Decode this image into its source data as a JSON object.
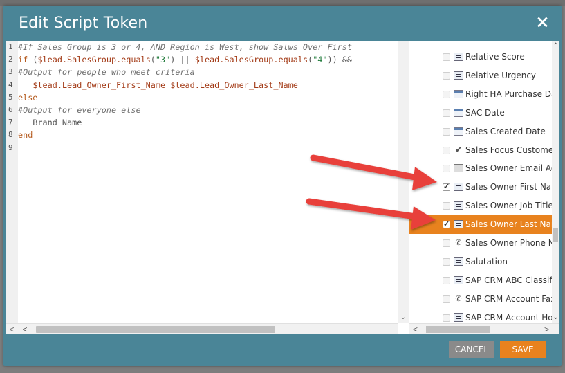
{
  "dialog": {
    "title": "Edit Script Token",
    "cancel_label": "CANCEL",
    "save_label": "SAVE"
  },
  "editor": {
    "line_numbers": [
      "1",
      "2",
      "3",
      "4",
      "5",
      "6",
      "7",
      "8",
      "9"
    ],
    "lines": [
      [
        {
          "t": "c-comment",
          "v": "#If Sales Group is 3 or 4, AND Region is West, show Salws Over First"
        }
      ],
      [
        {
          "t": "c-kw",
          "v": "if"
        },
        {
          "t": "c-op",
          "v": " ("
        },
        {
          "t": "c-var",
          "v": "$lead.SalesGroup.equals"
        },
        {
          "t": "c-op",
          "v": "("
        },
        {
          "t": "c-str",
          "v": "\"3\""
        },
        {
          "t": "c-op",
          "v": ") || "
        },
        {
          "t": "c-var",
          "v": "$lead.SalesGroup.equals"
        },
        {
          "t": "c-op",
          "v": "("
        },
        {
          "t": "c-str",
          "v": "\"4\""
        },
        {
          "t": "c-op",
          "v": ")) &&"
        }
      ],
      [
        {
          "t": "c-comment",
          "v": "#Output for people who meet criteria"
        }
      ],
      [
        {
          "t": "c-plain",
          "v": "   "
        },
        {
          "t": "c-var",
          "v": "$lead.Lead_Owner_First_Name"
        },
        {
          "t": "c-plain",
          "v": " "
        },
        {
          "t": "c-var",
          "v": "$lead.Lead_Owner_Last_Name"
        }
      ],
      [
        {
          "t": "c-kw",
          "v": "else"
        }
      ],
      [
        {
          "t": "c-comment",
          "v": "#Output for everyone else"
        }
      ],
      [
        {
          "t": "c-plain",
          "v": "   Brand Name"
        }
      ],
      [
        {
          "t": "c-kw",
          "v": "end"
        }
      ],
      [
        {
          "t": "c-plain",
          "v": ""
        }
      ]
    ]
  },
  "fields": [
    {
      "label": "Relative Score",
      "icon": "form-icon",
      "checked": false,
      "selected": false
    },
    {
      "label": "Relative Urgency",
      "icon": "form-icon",
      "checked": false,
      "selected": false
    },
    {
      "label": "Right HA Purchase Date",
      "icon": "calendar-icon",
      "checked": false,
      "selected": false
    },
    {
      "label": "SAC Date",
      "icon": "calendar-icon",
      "checked": false,
      "selected": false
    },
    {
      "label": "Sales Created Date",
      "icon": "calendar-icon",
      "checked": false,
      "selected": false
    },
    {
      "label": "Sales Focus Customer",
      "icon": "checkmark-icon",
      "checked": false,
      "selected": false
    },
    {
      "label": "Sales Owner Email Addr",
      "icon": "email-icon",
      "checked": false,
      "selected": false
    },
    {
      "label": "Sales Owner First Name",
      "icon": "form-icon",
      "checked": true,
      "selected": false
    },
    {
      "label": "Sales Owner Job Title",
      "icon": "form-icon",
      "checked": false,
      "selected": false
    },
    {
      "label": "Sales Owner Last Name",
      "icon": "form-icon",
      "checked": true,
      "selected": true
    },
    {
      "label": "Sales Owner Phone Nu",
      "icon": "phone-icon",
      "checked": false,
      "selected": false
    },
    {
      "label": "Salutation",
      "icon": "form-icon",
      "checked": false,
      "selected": false
    },
    {
      "label": "SAP CRM ABC Classifica",
      "icon": "form-icon",
      "checked": false,
      "selected": false
    },
    {
      "label": "SAP CRM Account Fax",
      "icon": "phone-icon",
      "checked": false,
      "selected": false
    },
    {
      "label": "SAP CRM Account Hous",
      "icon": "form-icon",
      "checked": false,
      "selected": false
    }
  ],
  "colors": {
    "dialog_bg": "#4a8597",
    "accent": "#e8821e",
    "cancel": "#8a8a8a",
    "annotation_arrow": "#e8403a"
  }
}
